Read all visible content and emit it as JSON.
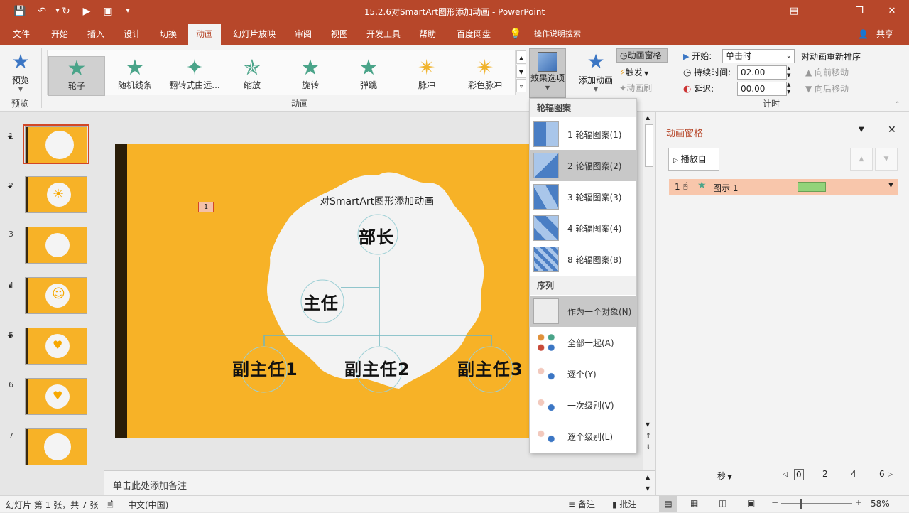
{
  "window": {
    "title": "15.2.6对SmartArt图形添加动画 - PowerPoint"
  },
  "tabs": [
    "文件",
    "开始",
    "插入",
    "设计",
    "切换",
    "动画",
    "幻灯片放映",
    "审阅",
    "视图",
    "开发工具",
    "帮助",
    "百度网盘"
  ],
  "tell_me": "操作说明搜索",
  "share": "共享",
  "ribbon": {
    "preview_label": "预览",
    "preview_group": "预览",
    "animation_group": "动画",
    "gallery": [
      "轮子",
      "随机线条",
      "翻转式由远...",
      "缩放",
      "旋转",
      "弹跳",
      "脉冲",
      "彩色脉冲"
    ],
    "effect_options": "效果选项",
    "add_animation": "添加动画",
    "anim_pane": "动画窗格",
    "trigger": "触发",
    "anim_painter": "动画刷",
    "start_label": "开始:",
    "start_value": "单击时",
    "duration_label": "持续时间:",
    "duration_value": "02.00",
    "delay_label": "延迟:",
    "delay_value": "00.00",
    "reorder": "对动画重新排序",
    "move_earlier": "向前移动",
    "move_later": "向后移动",
    "timing_group": "计时"
  },
  "dropdown": {
    "section1": "轮辐图案",
    "spokes": [
      "1 轮辐图案(1)",
      "2 轮辐图案(2)",
      "3 轮辐图案(3)",
      "4 轮辐图案(4)",
      "8 轮辐图案(8)"
    ],
    "section2": "序列",
    "sequence": [
      "作为一个对象(N)",
      "全部一起(A)",
      "逐个(Y)",
      "一次级别(V)",
      "逐个级别(L)"
    ]
  },
  "slide": {
    "title": "对SmartArt图形添加动画",
    "marker": "1",
    "nodes": {
      "boss": "部长",
      "director": "主任",
      "vice1": "副主任1",
      "vice2": "副主任2",
      "vice3": "副主任3"
    }
  },
  "thumbnails": [
    "1",
    "2",
    "3",
    "4",
    "5",
    "6",
    "7"
  ],
  "notes": "单击此处添加备注",
  "panel": {
    "title": "动画窗格",
    "play_from": "播放自",
    "item_number": "1",
    "item_name": "图示 1",
    "seconds": "秒",
    "ticks": [
      "0",
      "2",
      "4",
      "6"
    ]
  },
  "status": {
    "slide_info": "幻灯片 第 1 张，共 7 张",
    "language": "中文(中国)",
    "notes_btn": "备注",
    "comments_btn": "批注",
    "zoom": "58%"
  }
}
